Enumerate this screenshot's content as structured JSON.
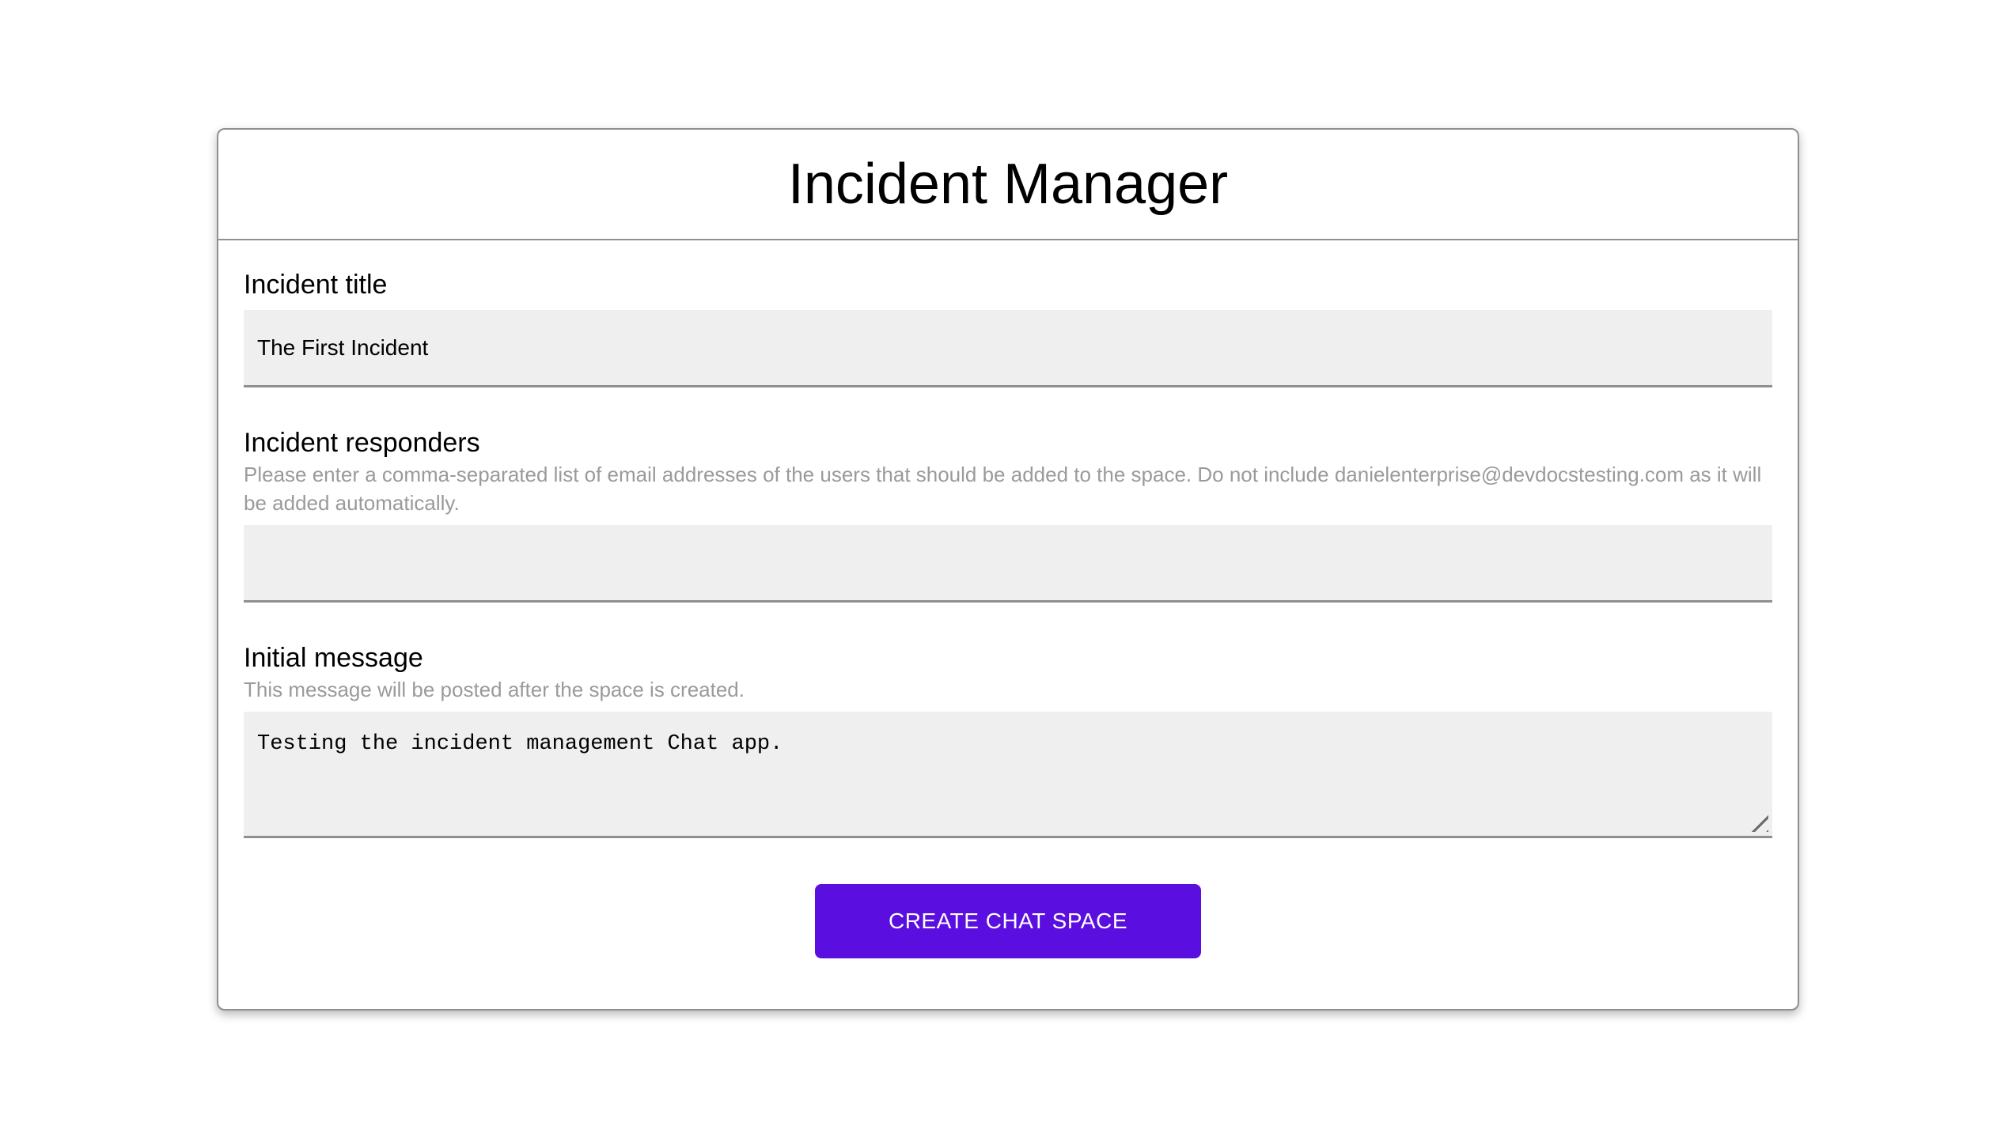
{
  "app": {
    "title": "Incident Manager"
  },
  "form": {
    "fields": [
      {
        "label": "Incident title",
        "helper": "",
        "value": "The First Incident",
        "type": "input"
      },
      {
        "label": "Incident responders",
        "helper": "Please enter a comma-separated list of email addresses of the users that should be added to the space. Do not include danielenterprise@devdocstesting.com as it will be added automatically.",
        "value": "",
        "type": "input"
      },
      {
        "label": "Initial message",
        "helper": "This message will be posted after the space is created.",
        "value": "Testing the incident management Chat app.",
        "type": "textarea"
      }
    ],
    "submit_label": "CREATE CHAT SPACE"
  },
  "colors": {
    "accent": "#5a0fe0",
    "helper_text": "#9a9a9a",
    "field_background": "#efefef",
    "field_border": "#8f8f8f",
    "card_border": "#909090"
  }
}
